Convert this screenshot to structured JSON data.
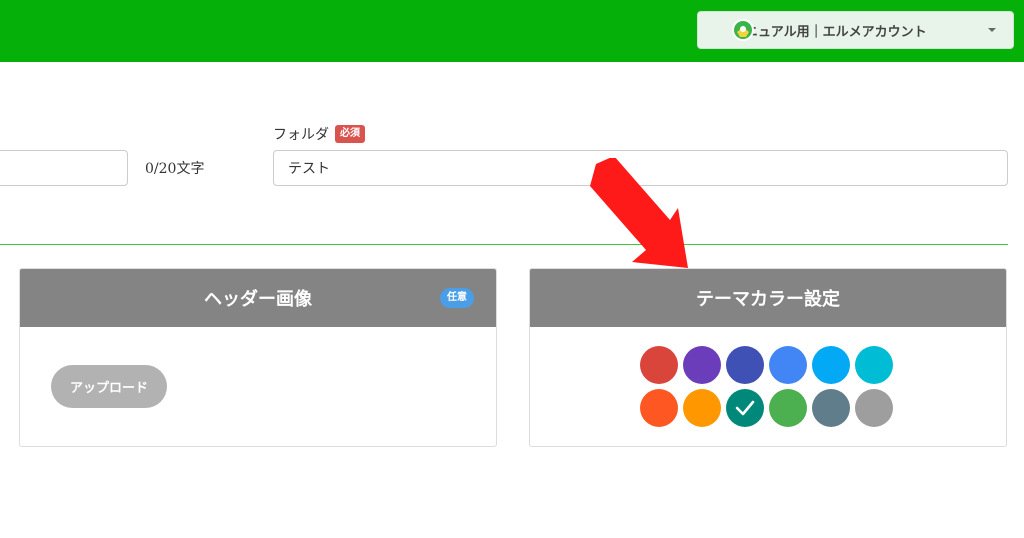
{
  "header": {
    "account_label": "マニュアル用｜エルメアカウント"
  },
  "form": {
    "char_count": "0/20文字",
    "folder_label": "フォルダ",
    "required_badge": "必須",
    "folder_value": "テスト"
  },
  "header_image_card": {
    "title": "ヘッダー画像",
    "optional_badge": "任意",
    "upload_label": "アップロード"
  },
  "theme_card": {
    "title": "テーマカラー設定",
    "colors": [
      {
        "hex": "#d9453b",
        "selected": false
      },
      {
        "hex": "#6b3dbb",
        "selected": false
      },
      {
        "hex": "#3f51b5",
        "selected": false
      },
      {
        "hex": "#4285f4",
        "selected": false
      },
      {
        "hex": "#03a9f4",
        "selected": false
      },
      {
        "hex": "#00bcd4",
        "selected": false
      },
      {
        "hex": "#ff5722",
        "selected": false
      },
      {
        "hex": "#ff9800",
        "selected": false
      },
      {
        "hex": "#00897b",
        "selected": true
      },
      {
        "hex": "#4caf50",
        "selected": false
      },
      {
        "hex": "#607d8b",
        "selected": false
      },
      {
        "hex": "#9e9e9e",
        "selected": false
      }
    ]
  },
  "colors": {
    "topbar": "#05b108",
    "divider": "#3cc83f",
    "card_header": "#848484",
    "annotation_arrow": "#ff1a1a"
  }
}
